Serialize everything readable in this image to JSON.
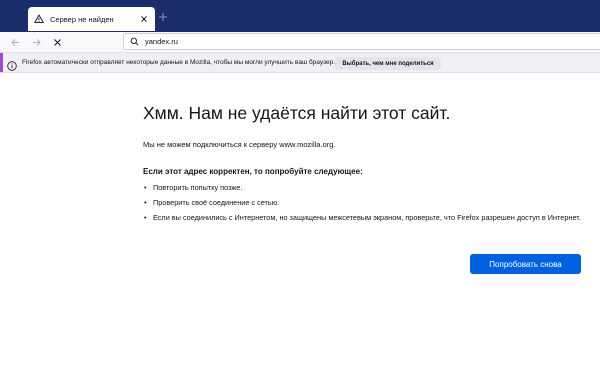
{
  "tab": {
    "title": "Сервер не найден",
    "favicon": "warning-icon"
  },
  "navbar": {
    "url": "yandex.ru",
    "back_icon": "arrow-left-icon",
    "forward_icon": "arrow-right-icon",
    "stop_icon": "close-icon",
    "search_icon": "search-icon"
  },
  "notification": {
    "message": "Firefox автоматически отправляет некоторые данные в Mozilla, чтобы мы могли улучшить ваш браузер.",
    "button_label": "Выбрать, чем мне поделиться",
    "accent_color": "#a248d8"
  },
  "error_page": {
    "title": "Хмм. Нам не удаётся найти этот сайт.",
    "subtitle": "Мы не можем подключиться к серверу www.mozilla.org.",
    "suggestion_heading": "Если этот адрес корректен, то попробуйте следующее:",
    "suggestions": [
      "Повторить попытку позже.",
      "Проверить своё соединение с сетью.",
      "Если вы соединились с Интернетом, но защищены межсетевым экраном, проверьте, что Firefox разрешен доступ в Интернет."
    ],
    "retry_label": "Попробовать снова",
    "retry_color": "#0061e0"
  },
  "colors": {
    "tabstrip": "#1b2d6b",
    "navbar": "#f9f9fb"
  }
}
